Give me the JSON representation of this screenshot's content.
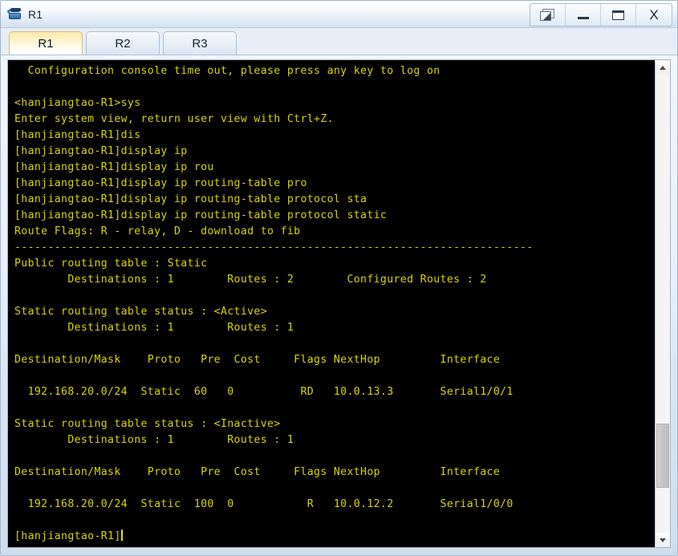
{
  "window": {
    "title": "R1",
    "icon": "router-icon",
    "controls": [
      {
        "name": "restore-windows-button",
        "label": ""
      },
      {
        "name": "minimize-button",
        "label": ""
      },
      {
        "name": "maximize-button",
        "label": ""
      },
      {
        "name": "close-button",
        "label": "X"
      }
    ]
  },
  "tabs": [
    {
      "label": "R1",
      "active": true
    },
    {
      "label": "R2",
      "active": false
    },
    {
      "label": "R3",
      "active": false
    }
  ],
  "terminal": {
    "foreground_color": "#d9d400",
    "background_color": "#000000",
    "prompt": "[hanjiangtao-R1]",
    "lines": [
      "  Configuration console time out, please press any key to log on",
      "",
      "<hanjiangtao-R1>sys",
      "Enter system view, return user view with Ctrl+Z.",
      "[hanjiangtao-R1]dis",
      "[hanjiangtao-R1]display ip",
      "[hanjiangtao-R1]display ip rou",
      "[hanjiangtao-R1]display ip routing-table pro",
      "[hanjiangtao-R1]display ip routing-table protocol sta",
      "[hanjiangtao-R1]display ip routing-table protocol static",
      "Route Flags: R - relay, D - download to fib",
      "------------------------------------------------------------------------------",
      "Public routing table : Static",
      "        Destinations : 1        Routes : 2        Configured Routes : 2",
      "",
      "Static routing table status : <Active>",
      "        Destinations : 1        Routes : 1",
      "",
      "Destination/Mask    Proto   Pre  Cost     Flags NextHop         Interface",
      "",
      "  192.168.20.0/24  Static  60   0          RD   10.0.13.3       Serial1/0/1",
      "",
      "Static routing table status : <Inactive>",
      "        Destinations : 1        Routes : 1",
      "",
      "Destination/Mask    Proto   Pre  Cost     Flags NextHop         Interface",
      "",
      "  192.168.20.0/24  Static  100  0           R   10.0.12.2       Serial1/0/0",
      "",
      "[hanjiangtao-R1]"
    ]
  },
  "scrollbar": {
    "up_arrow": "scroll-up-icon",
    "down_arrow": "scroll-down-icon"
  }
}
